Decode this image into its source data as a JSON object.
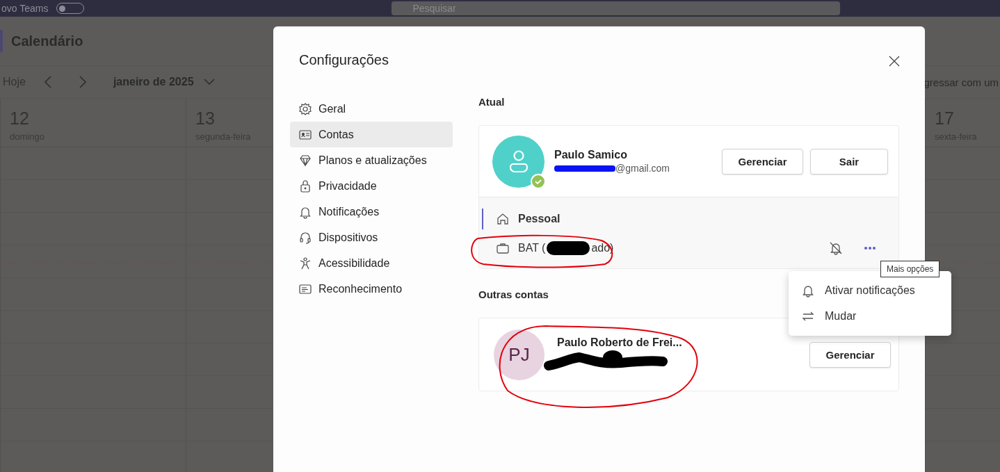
{
  "top_bar": {
    "app_label": "ovo Teams",
    "toggle": {
      "on": false
    },
    "search": {
      "placeholder": "Pesquisar"
    }
  },
  "calendar": {
    "title": "Calendário",
    "toolbar": {
      "today": "Hoje",
      "month": "janeiro de 2025",
      "join": "gressar com um"
    },
    "days": [
      {
        "number": "12",
        "weekday": "domingo"
      },
      {
        "number": "13",
        "weekday": "segunda-feira"
      },
      {
        "number": "17",
        "weekday": "sexta-feira"
      }
    ]
  },
  "dialog": {
    "title": "Configurações",
    "nav": [
      {
        "label": "Geral",
        "selected": false
      },
      {
        "label": "Contas",
        "selected": true
      },
      {
        "label": "Planos e atualizações",
        "selected": false
      },
      {
        "label": "Privacidade",
        "selected": false
      },
      {
        "label": "Notificações",
        "selected": false
      },
      {
        "label": "Dispositivos",
        "selected": false
      },
      {
        "label": "Acessibilidade",
        "selected": false
      },
      {
        "label": "Reconhecimento",
        "selected": false
      }
    ],
    "current_heading": "Atual",
    "current_account": {
      "name": "Paulo Samico",
      "email": "@gmail.com",
      "buttons": [
        "Gerenciar",
        "Sair"
      ]
    },
    "profiles": [
      {
        "kind": "personal",
        "label": "Pessoal",
        "selected": true
      },
      {
        "kind": "work",
        "label_start": "BAT (",
        "label_end": "ado)",
        "selected": false,
        "notifications_muted": true
      }
    ],
    "other_heading": "Outras contas",
    "other_accounts": [
      {
        "initials": "PJ",
        "name": "Paulo Roberto de Frei...",
        "button": "Gerenciar"
      }
    ],
    "tooltip": "Mais opções",
    "menu": [
      {
        "kind": "notify",
        "label": "Ativar notificações"
      },
      {
        "kind": "switch",
        "label": "Mudar"
      }
    ]
  }
}
